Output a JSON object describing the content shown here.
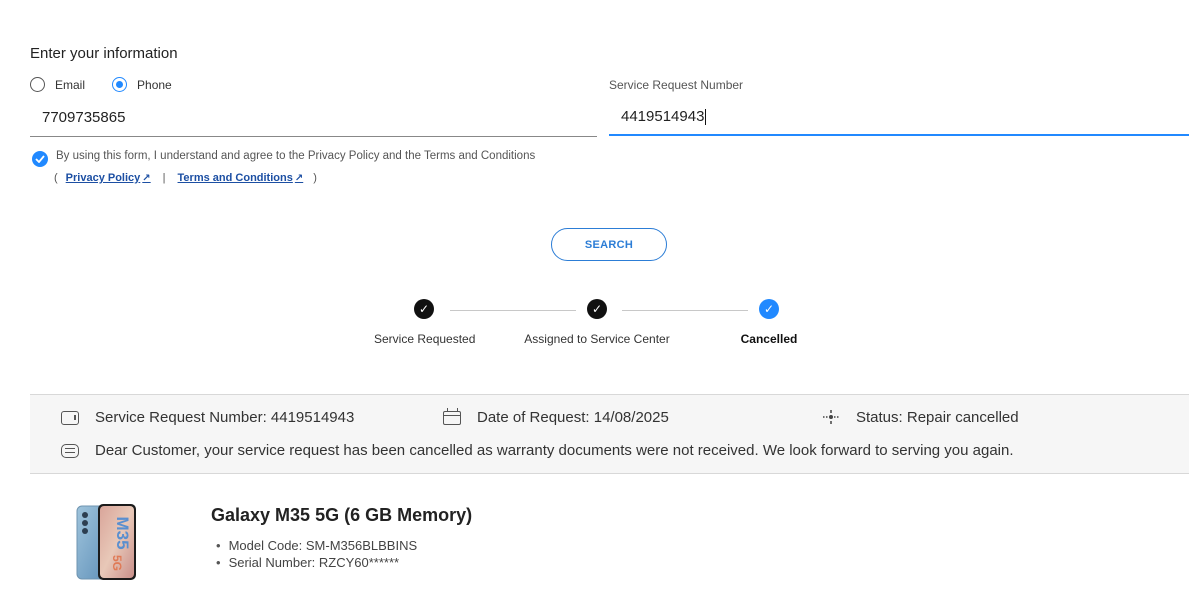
{
  "form": {
    "section_title": "Enter your information",
    "contact_options": [
      {
        "label": "Email",
        "selected": false
      },
      {
        "label": "Phone",
        "selected": true
      }
    ],
    "phone_value": "7709735865",
    "srn_label": "Service Request Number",
    "srn_value": "4419514943",
    "agree_text": "By using this form, I understand and agree to the Privacy Policy and the Terms and Conditions",
    "privacy_link": "Privacy Policy",
    "terms_link": "Terms and Conditions",
    "paren_open": "(",
    "paren_close": ")",
    "link_separator": "|",
    "search_label": "SEARCH"
  },
  "steps": [
    {
      "label": "Service Requested",
      "state": "done"
    },
    {
      "label": "Assigned to Service Center",
      "state": "done"
    },
    {
      "label": "Cancelled",
      "state": "current"
    }
  ],
  "details": {
    "srn": "Service Request Number: 4419514943",
    "date": "Date of Request: 14/08/2025",
    "status": "Status: Repair cancelled",
    "message": "Dear Customer, your service request has been cancelled as warranty documents were not received. We look forward to serving you again."
  },
  "product": {
    "name": "Galaxy M35 5G (6 GB Memory)",
    "model_code": "Model Code: SM-M356BLBBINS",
    "serial": "Serial Number: RZCY60******",
    "image_text": "M35",
    "image_text_small": "5G"
  },
  "colors": {
    "accent": "#2189ff",
    "link": "#1c4fa3",
    "step_done": "#111111",
    "info_bg": "#f6f6f6"
  }
}
